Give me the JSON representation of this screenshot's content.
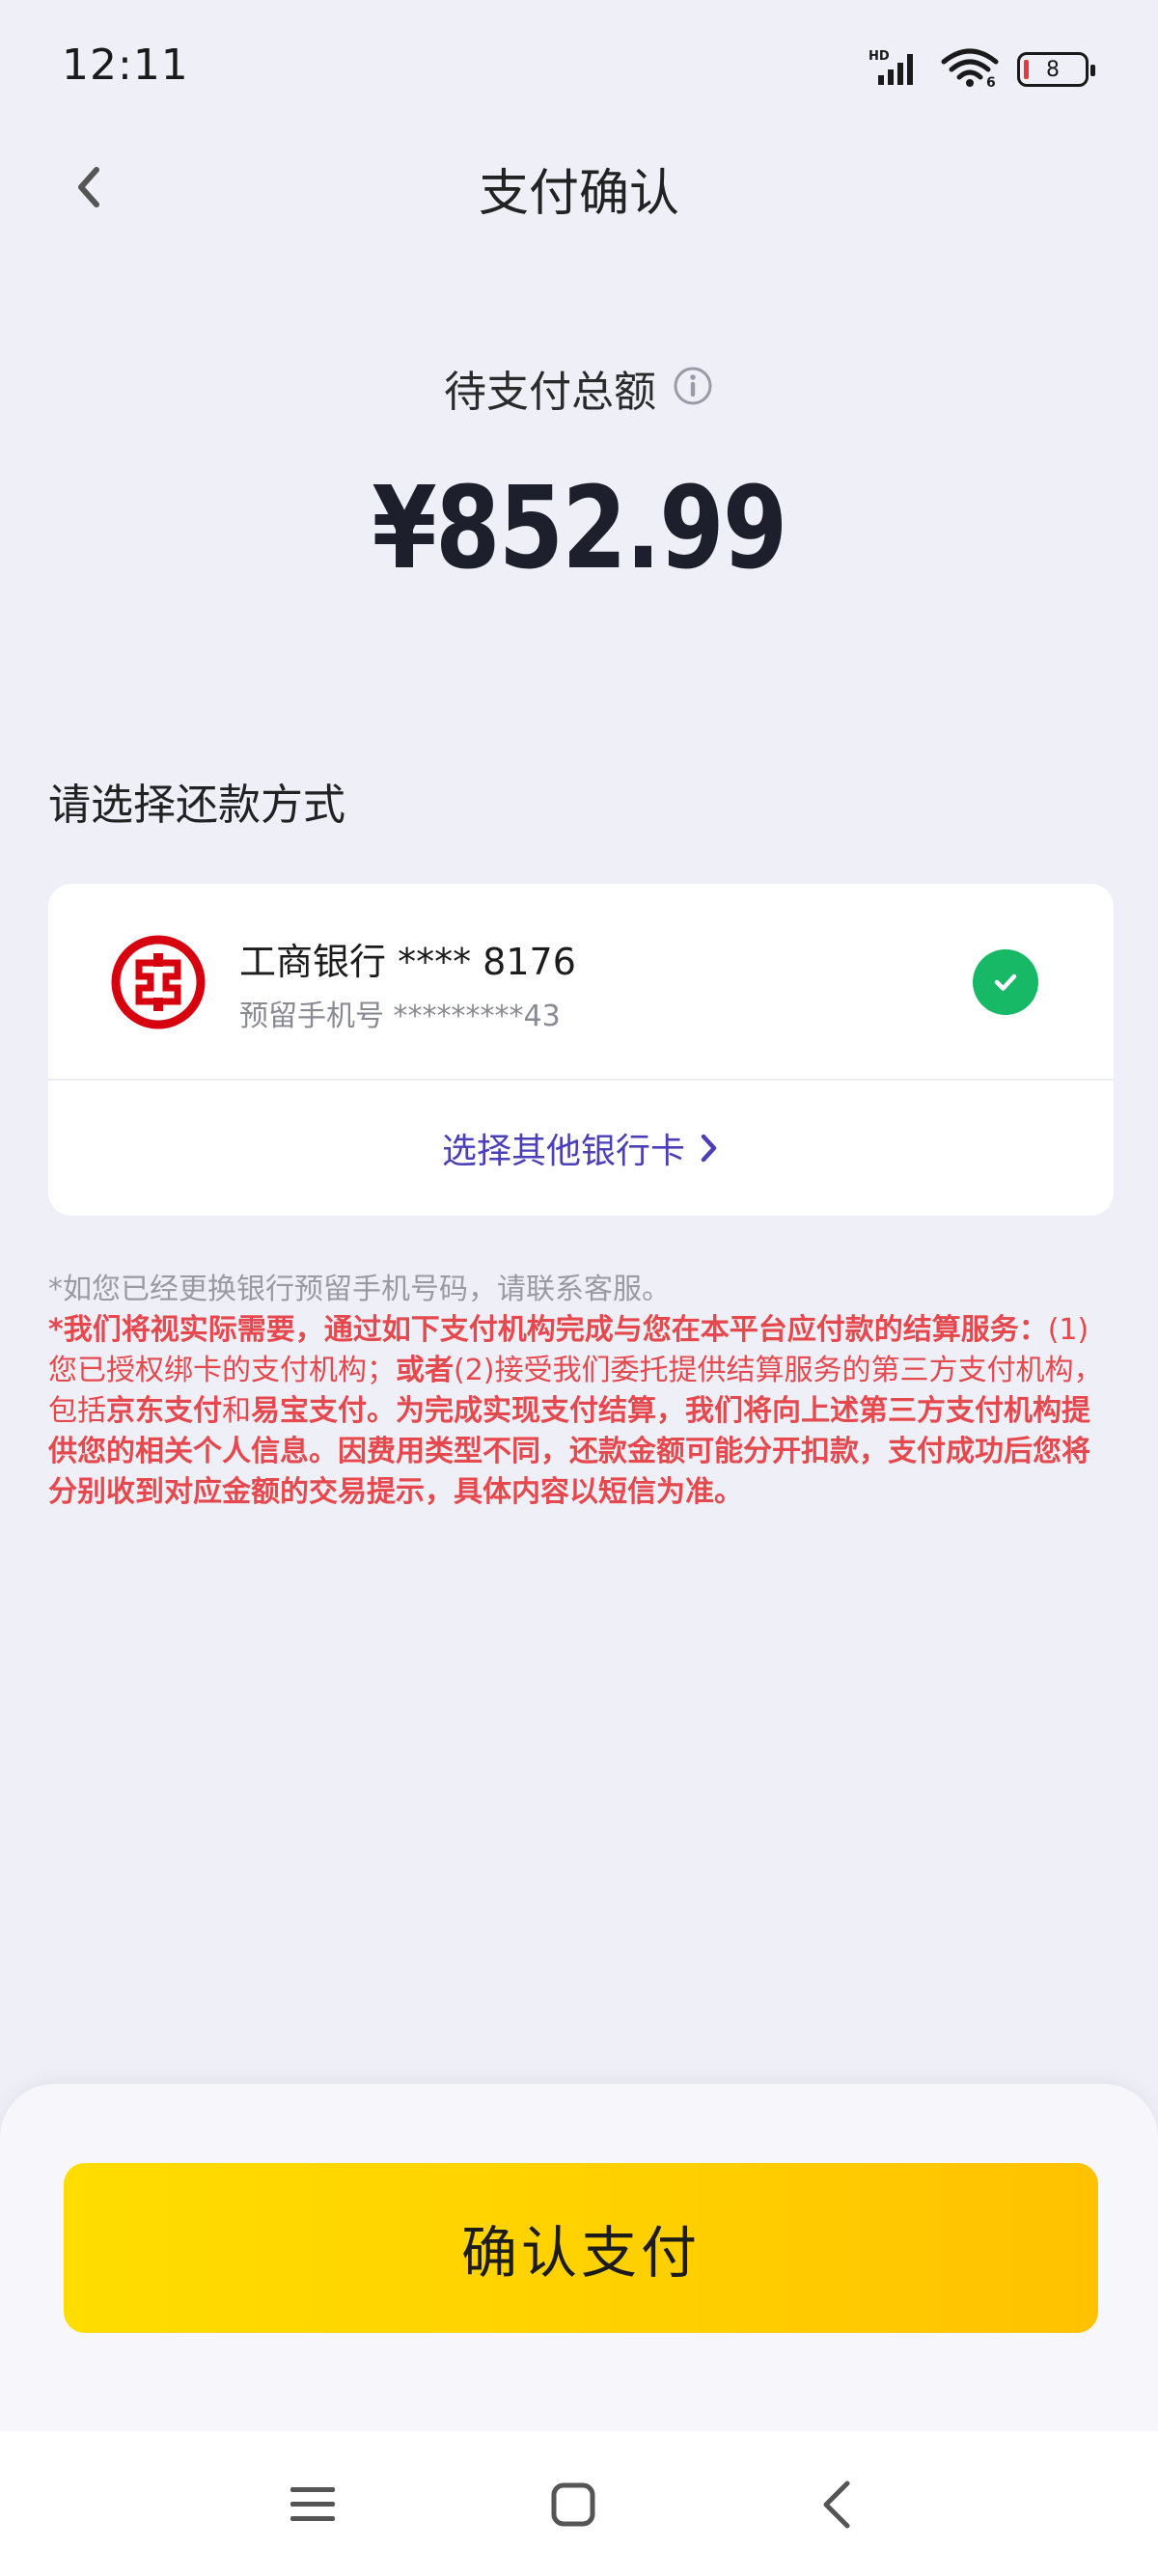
{
  "status_bar": {
    "time": "12:11",
    "network_label": "HD",
    "wifi_label": "6",
    "battery_level": "8"
  },
  "header": {
    "title": "支付确认",
    "back_icon": "chevron-left-icon"
  },
  "amount": {
    "label": "待支付总额",
    "info_icon": "info-icon",
    "value": "¥852.99"
  },
  "payment_method": {
    "section_title": "请选择还款方式",
    "bank": {
      "name": "工商银行 **** 8176",
      "phone": "预留手机号 *********43",
      "selected": true,
      "logo": "icbc-logo"
    },
    "other_card_label": "选择其他银行卡"
  },
  "notice": {
    "gray_line": "*如您已经更换银行预留手机号码，请联系客服。",
    "red_part1": "*我们将视实际需要，通过如下支付机构完成与您在本平台应付款的结算服务：",
    "red_part2": "(1)您已授权绑卡的支付机构；",
    "red_part3": "或者",
    "red_part4": "(2)接受我们委托提供结算服务的第三方支付机构，包括",
    "red_part5": "京东支付",
    "red_part6": "和",
    "red_part7": "易宝支付",
    "red_part8": "。为完成实现支付结算，我们将向上述第三方支付机构提供您的相关个人信息。因费用类型不同，还款金额可能分开扣款，支付成功后您将分别收到对应金额的交易提示，具体内容以短信为准。"
  },
  "footer": {
    "confirm_label": "确认支付"
  },
  "colors": {
    "background": "#efeff7",
    "accent_purple": "#4a3fb8",
    "check_green": "#17b866",
    "warning_red": "#e5484d",
    "button_yellow": "#ffd200",
    "icbc_red": "#d7000f"
  }
}
